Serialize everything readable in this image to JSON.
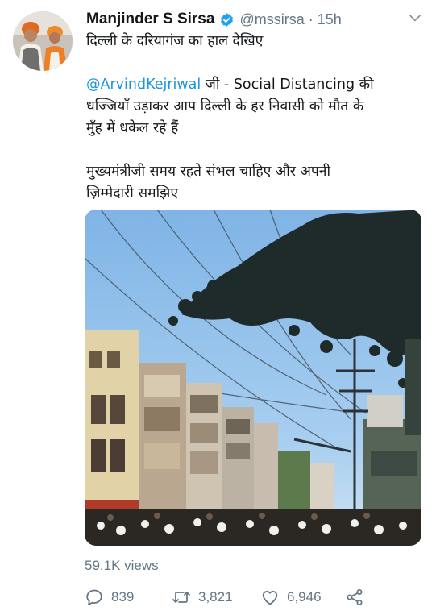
{
  "author": {
    "display_name": "Manjinder S Sirsa",
    "handle": "@mssirsa",
    "separator": "·",
    "timestamp": "15h",
    "verified": true
  },
  "tweet": {
    "line1": "दिल्ली के दरियागंज का हाल देखिए",
    "mention": "@ArvindKejriwal",
    "para2_rest_line1": " जी - Social Distancing की",
    "para2_line2": "धज्जियाँ उड़ाकर आप दिल्ली  के हर निवासी को मौत के",
    "para2_line3": "मुँह में धकेल रहे हैं",
    "para3_line1": "मुख्यमंत्रीजी समय रहते संभल चाहिए और अपनी",
    "para3_line2": "ज़िम्मेदारी समझिए"
  },
  "media": {
    "type": "video",
    "description_icons": [
      "tree-branch",
      "buildings",
      "utility-pole",
      "crowd"
    ]
  },
  "stats": {
    "views": "59.1K views"
  },
  "actions": {
    "replies": "839",
    "retweets": "3,821",
    "likes": "6,946"
  },
  "colors": {
    "link": "#1b95e0",
    "secondary_text": "#657786",
    "primary_text": "#14171a",
    "verified": "#1da1f2"
  }
}
